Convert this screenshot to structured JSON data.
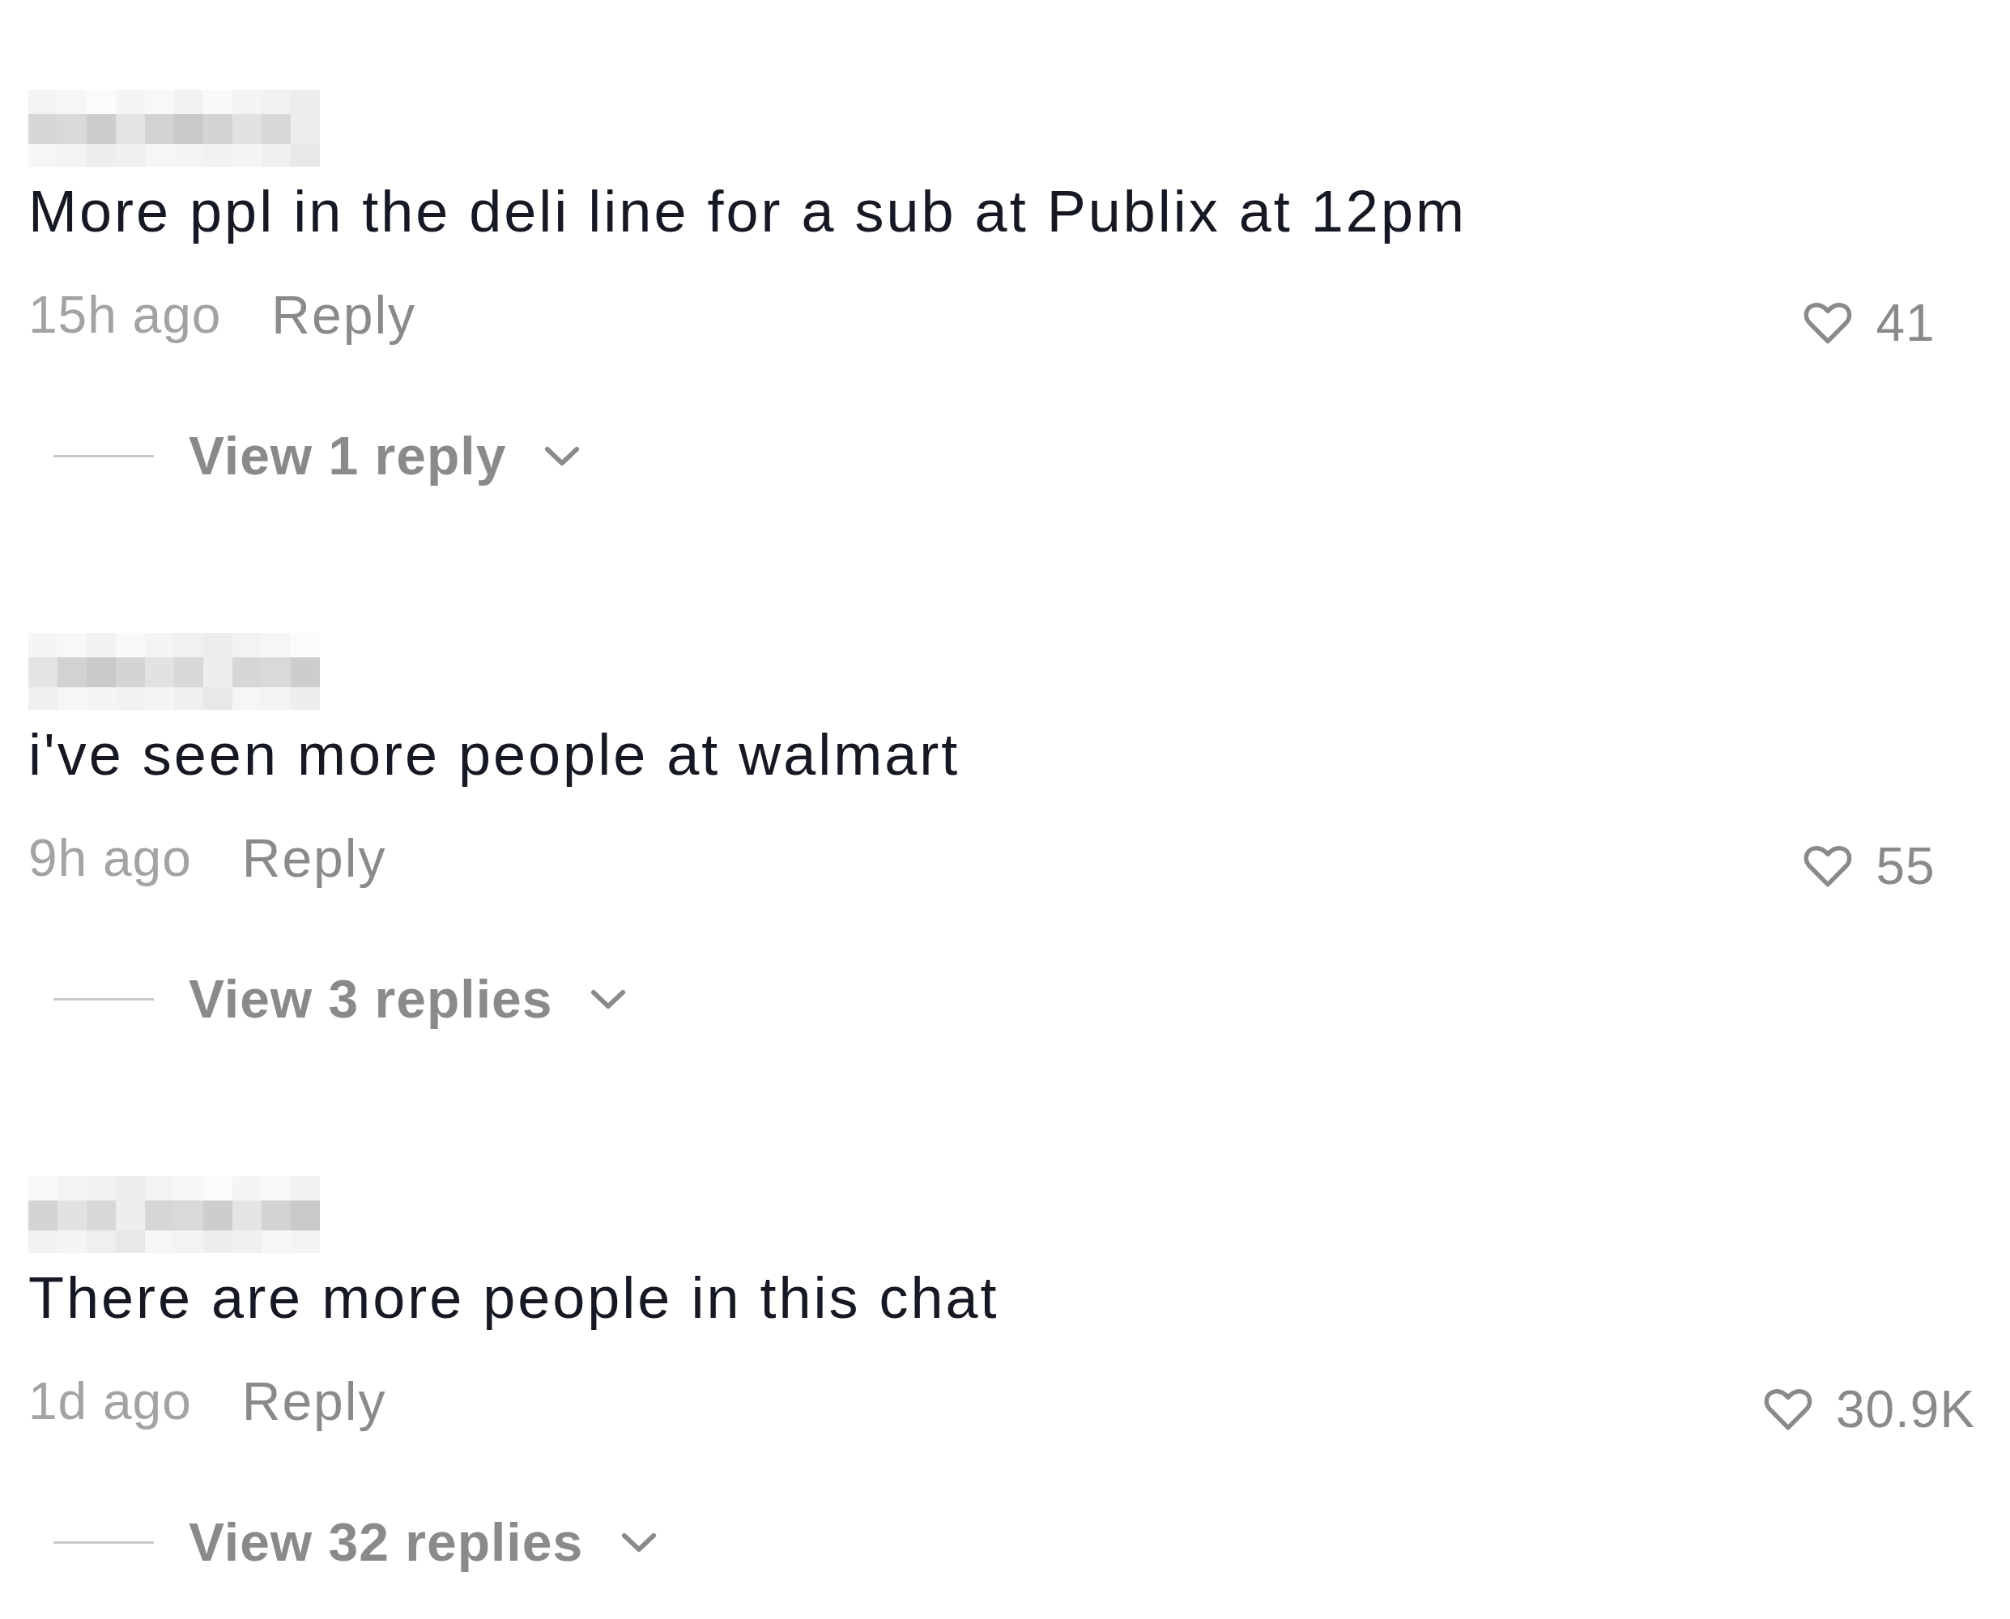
{
  "comments": [
    {
      "text": "More ppl in the deli line for a sub at Publix at 12pm",
      "time": "15h ago",
      "reply_label": "Reply",
      "likes": "41",
      "liked": false,
      "view_replies": "View 1 reply"
    },
    {
      "text": "i've seen more people at walmart",
      "time": "9h ago",
      "reply_label": "Reply",
      "likes": "55",
      "liked": false,
      "view_replies": "View 3 replies"
    },
    {
      "text": "There are more people in this chat",
      "time": "1d ago",
      "reply_label": "Reply",
      "likes": "30.9K",
      "liked": false,
      "view_replies": "View 32 replies"
    }
  ]
}
